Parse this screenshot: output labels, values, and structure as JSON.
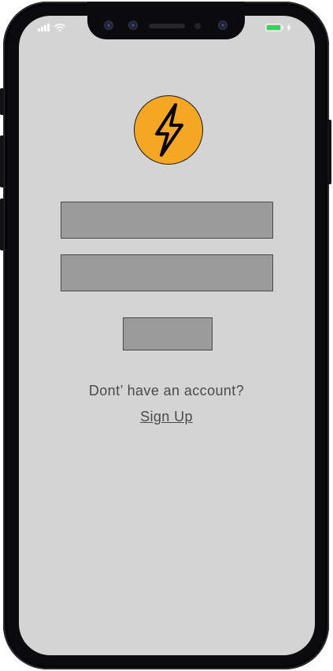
{
  "status_bar": {
    "signal_icon": "cellular-signal-icon",
    "wifi_icon": "wifi-icon",
    "battery_icon": "battery-icon",
    "battery_level": 1.0,
    "battery_color": "#38d45a",
    "charging_icon": "lightning-bolt-icon"
  },
  "logo": {
    "icon": "lightning-bolt-icon",
    "background_color": "#f5a623"
  },
  "login_form": {
    "username_value": "",
    "password_value": "",
    "submit_label": ""
  },
  "signup": {
    "prompt_text": "Dont’ have an account?",
    "link_text": "Sign Up"
  }
}
